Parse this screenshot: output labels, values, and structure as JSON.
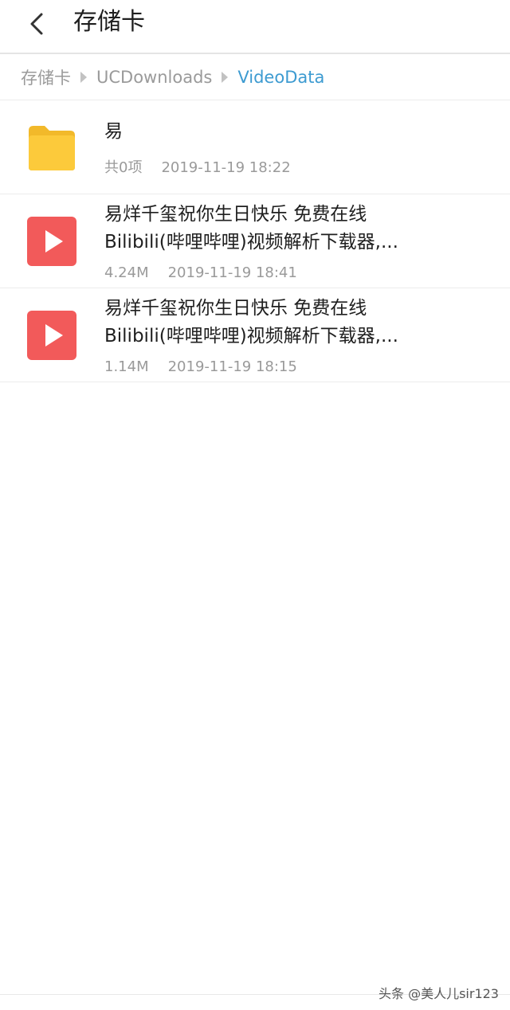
{
  "header": {
    "title": "存储卡"
  },
  "breadcrumb": [
    {
      "label": "存储卡"
    },
    {
      "label": "UCDownloads"
    },
    {
      "label": "VideoData"
    }
  ],
  "files": [
    {
      "type": "folder",
      "name": "易",
      "count": "共0项",
      "date": "2019-11-19 18:22"
    },
    {
      "type": "video",
      "name_line1": "易烊千玺祝你生日快乐 免费在线",
      "name_line2": "Bilibili(哔哩哔哩)视频解析下载器,...",
      "size": "4.24M",
      "date": "2019-11-19 18:41"
    },
    {
      "type": "video",
      "name_line1": "易烊千玺祝你生日快乐 免费在线",
      "name_line2": "Bilibili(哔哩哔哩)视频解析下载器,...",
      "size": "1.14M",
      "date": "2019-11-19 18:15"
    }
  ],
  "watermark": "头条 @美人儿sir123",
  "colors": {
    "folder": "#fcca3b",
    "video": "#f25a5a",
    "breadcrumb_active": "#3d9bd1"
  }
}
